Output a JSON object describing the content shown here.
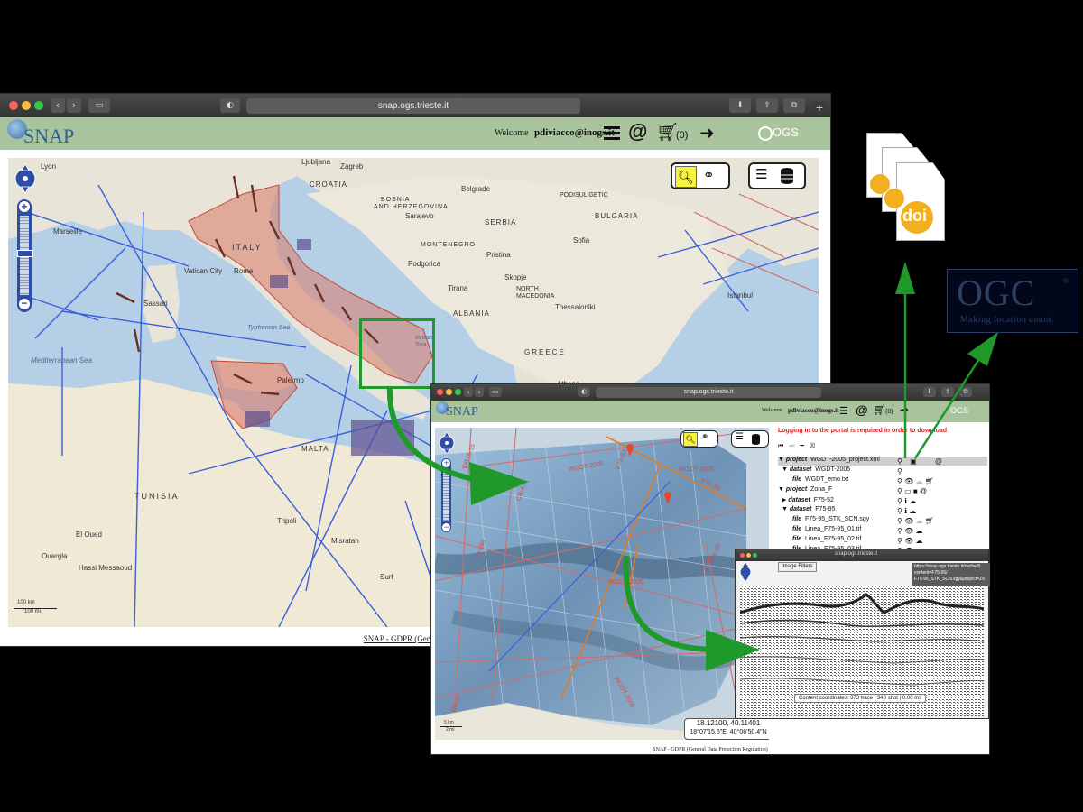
{
  "browser_main": {
    "url": "snap.ogs.trieste.it",
    "app_name": "SNAP",
    "welcome": "Welcome",
    "user": "pdiviacco@inogs.it",
    "cart_count": "(0)",
    "ogs_brand": "OGS",
    "footer": "SNAP - GDPR (General Data P"
  },
  "map_labels": [
    {
      "id": "lyon",
      "text": "Lyon"
    },
    {
      "id": "croatia",
      "text": "CROATIA"
    },
    {
      "id": "ljubljana",
      "text": "Ljubljana"
    },
    {
      "id": "zagreb",
      "text": "Zagreb"
    },
    {
      "id": "bosnia",
      "text": "BOSNIA"
    },
    {
      "id": "herzegovina",
      "text": "AND HERZEGOVINA"
    },
    {
      "id": "sarajevo",
      "text": "Sarajevo"
    },
    {
      "id": "belgrade",
      "text": "Belgrade"
    },
    {
      "id": "serbia",
      "text": "SERBIA"
    },
    {
      "id": "podisul",
      "text": "PODISUL GETIC"
    },
    {
      "id": "bulgaria",
      "text": "BULGARIA"
    },
    {
      "id": "sofia",
      "text": "Sofia"
    },
    {
      "id": "montenegro",
      "text": "MONTENEGRO"
    },
    {
      "id": "pristina",
      "text": "Pristina"
    },
    {
      "id": "podgorica",
      "text": "Podgorica"
    },
    {
      "id": "skopje",
      "text": "Skopje"
    },
    {
      "id": "tirana",
      "text": "Tirana"
    },
    {
      "id": "north_macedonia",
      "text": "NORTH MACEDONIA"
    },
    {
      "id": "albania",
      "text": "ALBANIA"
    },
    {
      "id": "thessaloniki",
      "text": "Thessaloniki"
    },
    {
      "id": "istanbul",
      "text": "Istanbul"
    },
    {
      "id": "greece",
      "text": "GREECE"
    },
    {
      "id": "marseille",
      "text": "Marseille"
    },
    {
      "id": "italy",
      "text": "ITALY"
    },
    {
      "id": "vatican",
      "text": "Vatican City"
    },
    {
      "id": "rome",
      "text": "Rome"
    },
    {
      "id": "sassari",
      "text": "Sassari"
    },
    {
      "id": "tyrrhenian",
      "text": "Tyrrhenian Sea"
    },
    {
      "id": "mediterranean",
      "text": "Mediterranean Sea"
    },
    {
      "id": "palermo",
      "text": "Palermo"
    },
    {
      "id": "malta",
      "text": "MALTA"
    },
    {
      "id": "tunisia",
      "text": "TUNISIA"
    },
    {
      "id": "el_oued",
      "text": "El Oued"
    },
    {
      "id": "ouargla",
      "text": "Ouargla"
    },
    {
      "id": "hassi",
      "text": "Hassi Messaoud"
    },
    {
      "id": "tripoli",
      "text": "Tripoli"
    },
    {
      "id": "misratah",
      "text": "Misratah"
    },
    {
      "id": "surt",
      "text": "Surt"
    },
    {
      "id": "athens",
      "text": "Athens"
    },
    {
      "id": "ionian",
      "text": "Ionian Sea"
    }
  ],
  "scale": {
    "km": "100 km",
    "mi": "100 mi"
  },
  "browser_detail": {
    "url": "snap.ogs.trieste.it",
    "app_name": "SNAP",
    "welcome": "Welcome",
    "user": "pdiviacco@inogs.it",
    "cart_count": "(0)",
    "ogs_brand": "OGS",
    "login_notice": "Logging in to the portal is required in order to download",
    "footer": "SNAP - GDPR (General Data Protection Regulation)",
    "coords_line1": "18.12100, 40.11401",
    "coords_line2": "18°07'15.6\"E, 40°06'50.4\"N",
    "scale_km": "5 km",
    "scale_mi": "2 mi"
  },
  "tree": [
    {
      "type": "project",
      "name": "WGDT-2005_project.xml"
    },
    {
      "type": "dataset",
      "name": "WGDT-2005"
    },
    {
      "type": "file",
      "name": "WGDT_emo.txt"
    },
    {
      "type": "project",
      "name": "Zona_F"
    },
    {
      "type": "dataset",
      "name": "F75-52"
    },
    {
      "type": "dataset",
      "name": "F75-95"
    },
    {
      "type": "file",
      "name": "F75-95_STK_SCN.sgy"
    },
    {
      "type": "file",
      "name": "Linea_F75-95_01.tif"
    },
    {
      "type": "file",
      "name": "Linea_F75-95_02.tif"
    },
    {
      "type": "file",
      "name": "Linea_F75-95_03.tif"
    }
  ],
  "seismic_window": {
    "url": "snap.ogs.trieste.it",
    "image_filters": "Image Filters",
    "tooltip": [
      "https://snap.ogs.trieste.it/cache/fi",
      "content=F75-95/",
      "F75-95_STK_SCN.sgy&project=Zo"
    ],
    "content_coords": "Content coordinates: 373 trace | 340 shot | 0.00 ms"
  },
  "map_line_labels": [
    "WGDT-2005",
    "WGDT-2005",
    "F75-30",
    "F75-80",
    "D-496",
    "WGDT-2005",
    "WGDT-2005",
    "F75-95",
    "F75-80",
    "DR75-15",
    "DR-11",
    "CR-47"
  ],
  "logos": {
    "doi": "doi",
    "ogc": "OGC",
    "ogc_tagline": "Making location count."
  },
  "colors": {
    "appbar": "#a9c49c",
    "arrow": "#1f9a2a",
    "zoom": "#2d4da8",
    "highlight": "#f7f23d",
    "login": "#e01b1b"
  }
}
